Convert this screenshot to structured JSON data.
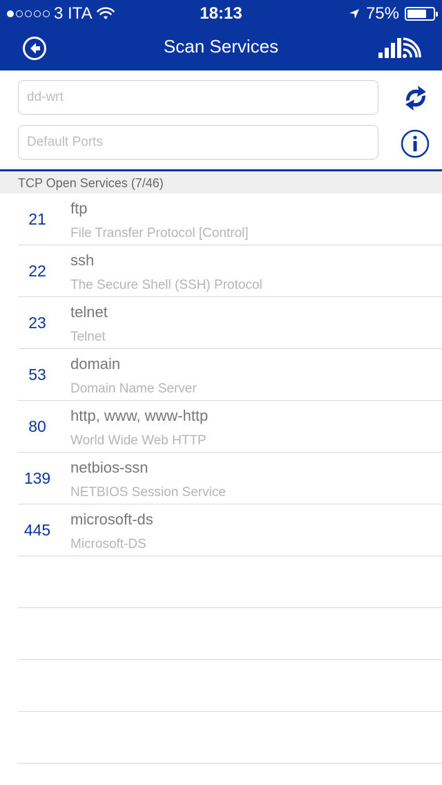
{
  "status_bar": {
    "carrier": "3 ITA",
    "time": "18:13",
    "battery_label": "75%",
    "battery_level": 0.75
  },
  "nav": {
    "title": "Scan Services"
  },
  "inputs": {
    "host_placeholder": "dd-wrt",
    "ports_placeholder": "Default Ports"
  },
  "section": {
    "title": "TCP Open Services (7/46)"
  },
  "services": [
    {
      "port": "21",
      "name": "ftp",
      "description": "File Transfer Protocol [Control]"
    },
    {
      "port": "22",
      "name": "ssh",
      "description": "The Secure Shell (SSH) Protocol"
    },
    {
      "port": "23",
      "name": "telnet",
      "description": "Telnet"
    },
    {
      "port": "53",
      "name": "domain",
      "description": "Domain Name Server"
    },
    {
      "port": "80",
      "name": "http, www, www-http",
      "description": "World Wide Web HTTP"
    },
    {
      "port": "139",
      "name": "netbios-ssn",
      "description": "NETBIOS Session Service"
    },
    {
      "port": "445",
      "name": "microsoft-ds",
      "description": "Microsoft-DS"
    }
  ],
  "icons": {
    "back": "back-arrow-circle-icon",
    "signal": "signal-wifi-icon",
    "refresh": "refresh-arrows-icon",
    "info": "info-circle-icon"
  },
  "colors": {
    "brand": "#0a34a0",
    "section_bg": "#efefef",
    "divider": "#d8d8d8"
  }
}
